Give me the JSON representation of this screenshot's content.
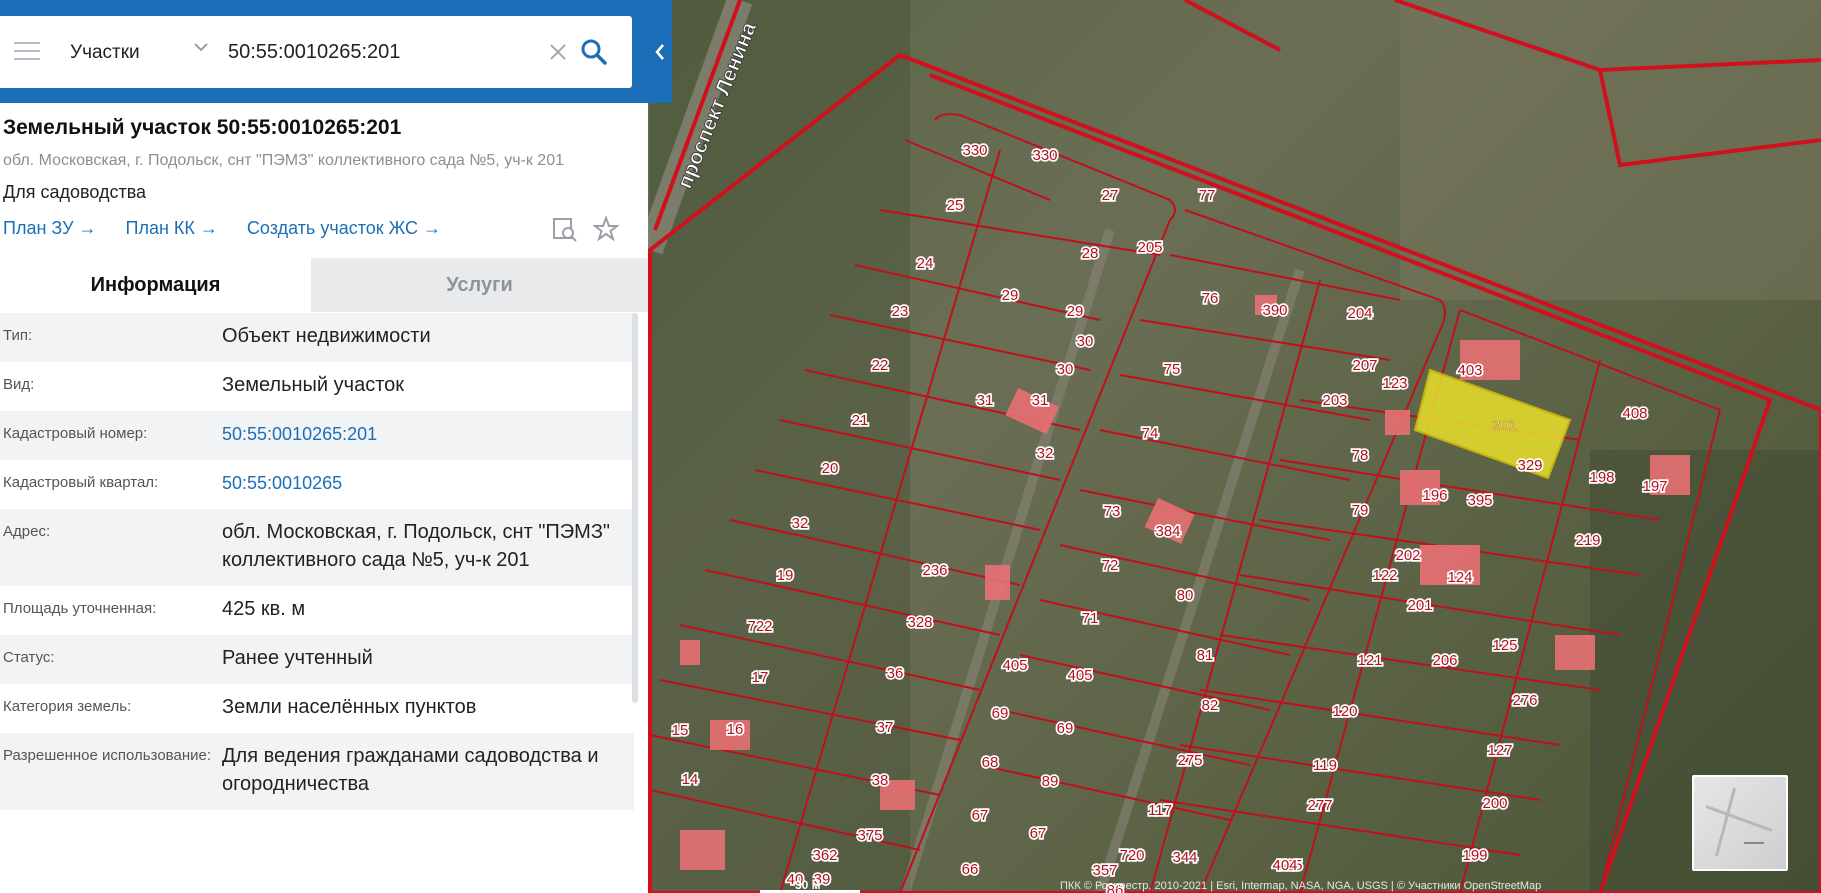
{
  "search": {
    "category": "Участки",
    "query": "50:55:0010265:201"
  },
  "parcel": {
    "title": "Земельный участок 50:55:0010265:201",
    "address_sub": "обл. Московская, г. Подольск, снт \"ПЭМЗ\" коллективного сада №5, уч-к 201",
    "purpose": "Для садоводства",
    "links": [
      "План ЗУ →",
      "План КК →",
      "Создать участок ЖС →"
    ]
  },
  "tabs": {
    "info": "Информация",
    "services": "Услуги"
  },
  "info": {
    "rows": [
      {
        "key": "Тип:",
        "value": "Объект недвижимости"
      },
      {
        "key": "Вид:",
        "value": "Земельный участок"
      },
      {
        "key": "Кадастровый номер:",
        "value": "50:55:0010265:201"
      },
      {
        "key": "Кадастровый квартал:",
        "value": "50:55:0010265"
      },
      {
        "key": "Адрес:",
        "value": "обл. Московская, г. Подольск, снт \"ПЭМЗ\" коллективного сада №5, уч-к 201"
      },
      {
        "key": "Площадь уточненная:",
        "value": "425 кв. м"
      },
      {
        "key": "Статус:",
        "value": "Ранее учтенный"
      },
      {
        "key": "Категория земель:",
        "value": "Земли населённых пунктов"
      },
      {
        "key": "Разрешенное использование:",
        "value": "Для ведения гражданами садоводства и огородничества"
      }
    ]
  },
  "map": {
    "street_label": "проспект Ленина",
    "scale_label": "30 м",
    "attribution": "ПКК © Росреестр, 2010-2021 | Esri, Intermap, NASA, NGA, USGS | © Участники OpenStreetMap",
    "parcel_labels": [
      "330",
      "25",
      "27",
      "24",
      "28",
      "23",
      "29",
      "22",
      "30",
      "21",
      "31",
      "20",
      "32",
      "19",
      "722",
      "17",
      "16",
      "15",
      "14",
      "39",
      "40",
      "236",
      "328",
      "36",
      "37",
      "38",
      "375",
      "362",
      "405",
      "69",
      "68",
      "67",
      "66",
      "330",
      "29",
      "30",
      "31",
      "32",
      "73",
      "72",
      "71",
      "405",
      "69",
      "89",
      "67",
      "86",
      "357",
      "720",
      "205",
      "77",
      "390",
      "76",
      "75",
      "74",
      "384",
      "80",
      "81",
      "82",
      "275",
      "117",
      "344",
      "725",
      "204",
      "207",
      "203",
      "78",
      "79",
      "122",
      "121",
      "120",
      "119",
      "277",
      "404",
      "202",
      "201",
      "206",
      "403",
      "123",
      "329",
      "196",
      "395",
      "124",
      "125",
      "276",
      "127",
      "200",
      "199",
      "408",
      "198",
      "197",
      "219"
    ],
    "highlight_label": "201"
  },
  "colors": {
    "accent": "#1b6fb8",
    "parcel_border": "#d0101c",
    "highlight": "#e8e02c"
  }
}
